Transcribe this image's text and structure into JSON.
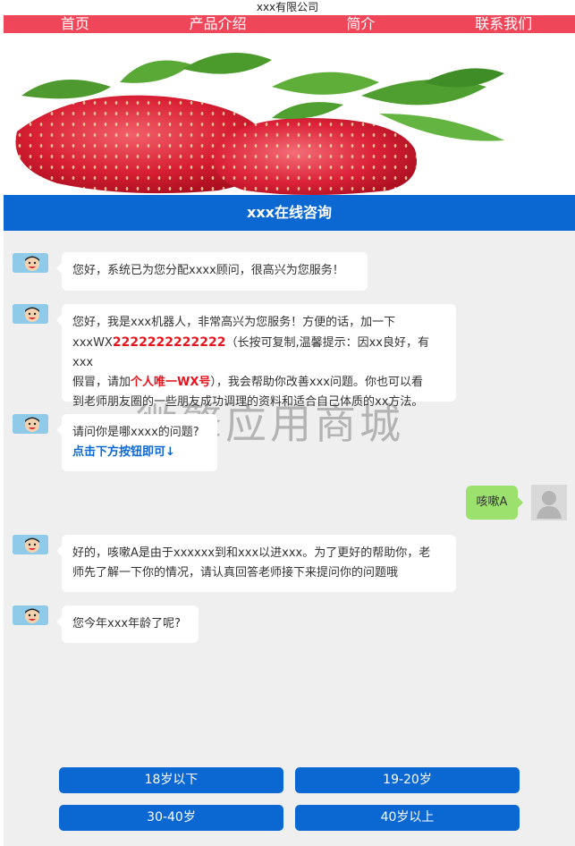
{
  "company_name": "xxx有限公司",
  "nav": [
    "首页",
    "产品介绍",
    "简介",
    "联系我们"
  ],
  "chat_title": "xxx在线咨询",
  "messages": {
    "m1": "您好，系统已为您分配xxxx顾问，很高兴为您服务！",
    "m2": {
      "a": "您好，我是xxx机器人，非常高兴为您服务！方便的话，加一下",
      "b": "xxxWX",
      "c": "2222222222222",
      "d": "（长按可复制,温馨提示：因xx良好，有xxx",
      "e": "假冒，请加",
      "f": "个人唯一WX号",
      "g": "），我会帮助你改善xxx问题。你也可以看",
      "h": "到老师朋友圈的一些朋友成功调理的资料和适合自己体质的xx方法。"
    },
    "m3": {
      "a": "请问你是哪xxxx的问题?",
      "b": "点击下方按钮即可↓"
    },
    "user_reply": "咳嗽A",
    "m4": {
      "a": "好的，咳嗽A是由于xxxxxx到和xxx以进xxx。为了更好的帮助你，老",
      "b": "师先了解一下你的情况，请认真回答老师接下来提问你的问题哦"
    },
    "m5": "您今年xxx年龄了呢?"
  },
  "watermark": "微擎应用商城",
  "options": [
    "18岁以下",
    "19-20岁",
    "30-40岁",
    "40岁以上"
  ],
  "colors": {
    "nav": "#f0465a",
    "header": "#0b67d2",
    "user_bubble": "#9ce06d",
    "highlight": "#e8141e"
  },
  "icons": {
    "bot_avatar": "cartoon-avatar-icon",
    "user_avatar": "user-silhouette-icon",
    "banner": "strawberry-image"
  }
}
